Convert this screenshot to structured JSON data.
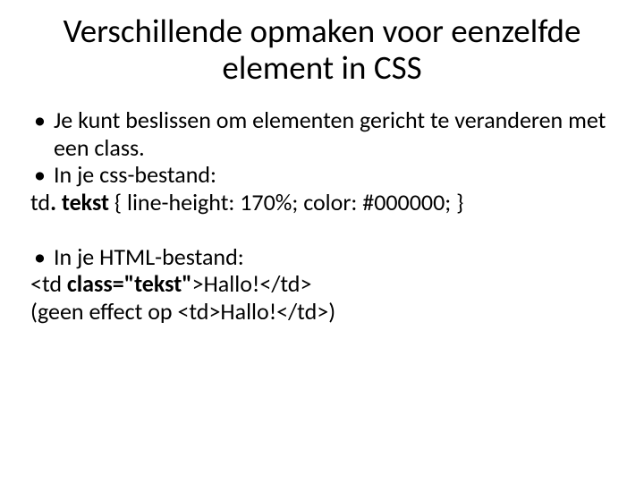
{
  "title": "Verschillende opmaken voor eenzelfde element in CSS",
  "b1": "Je kunt beslissen om elementen gericht te veranderen met een class.",
  "b2": "In je css-bestand:",
  "css_line_pre": "td",
  "css_line_bold": ". tekst",
  "css_line_post": " { line-height: 170%; color: #000000; }",
  "b3": "In je HTML-bestand:",
  "html_line_pre": "<td ",
  "html_line_bold": "class=\"tekst\"",
  "html_line_post": ">Hallo!</td>",
  "note": "(geen effect op <td>Hallo!</td>)"
}
